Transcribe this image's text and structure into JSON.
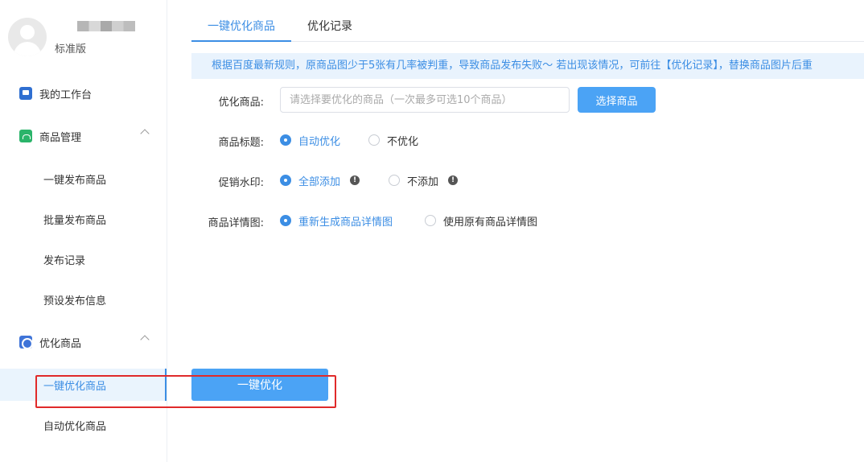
{
  "profile": {
    "edition": "标准版"
  },
  "sidebar": {
    "items": [
      {
        "label": "我的工作台",
        "icon": "desk-icon"
      },
      {
        "label": "商品管理",
        "icon": "shop-icon",
        "expanded": true,
        "children": [
          "一键发布商品",
          "批量发布商品",
          "发布记录",
          "预设发布信息"
        ]
      },
      {
        "label": "优化商品",
        "icon": "optimize-icon",
        "expanded": true,
        "children": [
          "一键优化商品",
          "自动优化商品"
        ]
      }
    ],
    "active_item": "一键优化商品"
  },
  "tabs": [
    {
      "label": "一键优化商品",
      "active": true
    },
    {
      "label": "优化记录",
      "active": false
    }
  ],
  "notice": "根据百度最新规则，原商品图少于5张有几率被判重，导致商品发布失败～ 若出现该情况，可前往【优化记录】，替换商品图片后重",
  "form": {
    "product": {
      "label": "优化商品:",
      "placeholder": "请选择要优化的商品（一次最多可选10个商品）",
      "button": "选择商品"
    },
    "title": {
      "label": "商品标题:",
      "options": [
        "自动优化",
        "不优化"
      ],
      "selected": "自动优化"
    },
    "watermark": {
      "label": "促销水印:",
      "options": [
        "全部添加",
        "不添加"
      ],
      "selected": "全部添加"
    },
    "detail": {
      "label": "商品详情图:",
      "options": [
        "重新生成商品详情图",
        "使用原有商品详情图"
      ],
      "selected": "重新生成商品详情图"
    }
  },
  "action": {
    "label": "一键优化"
  },
  "colors": {
    "primary": "#4ba3f5",
    "active_text": "#3c8ee4",
    "highlight": "#e02a2a"
  }
}
